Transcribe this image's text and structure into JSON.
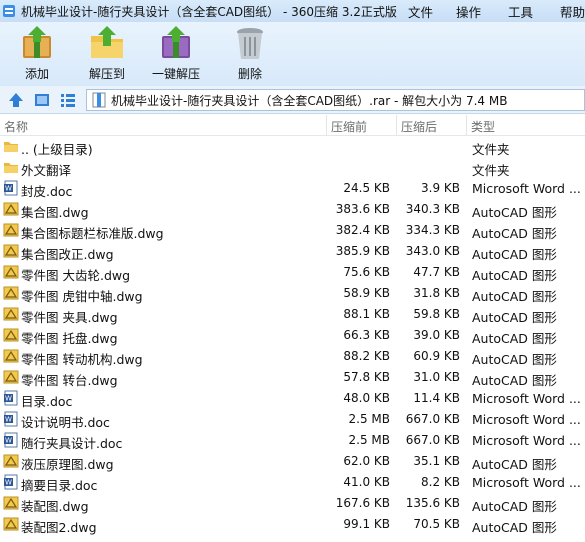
{
  "window": {
    "title": "机械毕业设计-随行夹具设计（含全套CAD图纸） - 360压缩 3.2正式版"
  },
  "menu": {
    "items": [
      "文件",
      "操作",
      "工具",
      "帮助"
    ]
  },
  "toolbar": {
    "buttons": [
      {
        "label": "添加",
        "icon": "add-archive-icon"
      },
      {
        "label": "解压到",
        "icon": "extract-folder-icon"
      },
      {
        "label": "一键解压",
        "icon": "one-click-extract-icon"
      },
      {
        "label": "删除",
        "icon": "trash-can-icon"
      }
    ]
  },
  "address": {
    "path": "机械毕业设计-随行夹具设计（含全套CAD图纸）.rar - 解包大小为 7.4 MB"
  },
  "columns": {
    "name": "名称",
    "original": "压缩前",
    "compressed": "压缩后",
    "type": "类型"
  },
  "files": [
    {
      "name": ".. (上级目录)",
      "original": "",
      "compressed": "",
      "type": "文件夹",
      "icon": "folder-icon"
    },
    {
      "name": "外文翻译",
      "original": "",
      "compressed": "",
      "type": "文件夹",
      "icon": "folder-icon"
    },
    {
      "name": "封皮.doc",
      "original": "24.5 KB",
      "compressed": "3.9 KB",
      "type": "Microsoft Word ...",
      "icon": "word-doc-icon"
    },
    {
      "name": "集合图.dwg",
      "original": "383.6 KB",
      "compressed": "340.3 KB",
      "type": "AutoCAD 图形",
      "icon": "autocad-dwg-icon"
    },
    {
      "name": "集合图标题栏标准版.dwg",
      "original": "382.4 KB",
      "compressed": "334.3 KB",
      "type": "AutoCAD 图形",
      "icon": "autocad-dwg-icon"
    },
    {
      "name": "集合图改正.dwg",
      "original": "385.9 KB",
      "compressed": "343.0 KB",
      "type": "AutoCAD 图形",
      "icon": "autocad-dwg-icon"
    },
    {
      "name": "零件图 大齿轮.dwg",
      "original": "75.6 KB",
      "compressed": "47.7 KB",
      "type": "AutoCAD 图形",
      "icon": "autocad-dwg-icon"
    },
    {
      "name": "零件图 虎钳中轴.dwg",
      "original": "58.9 KB",
      "compressed": "31.8 KB",
      "type": "AutoCAD 图形",
      "icon": "autocad-dwg-icon"
    },
    {
      "name": "零件图 夹具.dwg",
      "original": "88.1 KB",
      "compressed": "59.8 KB",
      "type": "AutoCAD 图形",
      "icon": "autocad-dwg-icon"
    },
    {
      "name": "零件图 托盘.dwg",
      "original": "66.3 KB",
      "compressed": "39.0 KB",
      "type": "AutoCAD 图形",
      "icon": "autocad-dwg-icon"
    },
    {
      "name": "零件图 转动机构.dwg",
      "original": "88.2 KB",
      "compressed": "60.9 KB",
      "type": "AutoCAD 图形",
      "icon": "autocad-dwg-icon"
    },
    {
      "name": "零件图 转台.dwg",
      "original": "57.8 KB",
      "compressed": "31.0 KB",
      "type": "AutoCAD 图形",
      "icon": "autocad-dwg-icon"
    },
    {
      "name": "目录.doc",
      "original": "48.0 KB",
      "compressed": "11.4 KB",
      "type": "Microsoft Word ...",
      "icon": "word-doc-icon"
    },
    {
      "name": "设计说明书.doc",
      "original": "2.5 MB",
      "compressed": "667.0 KB",
      "type": "Microsoft Word ...",
      "icon": "word-doc-icon"
    },
    {
      "name": "随行夹具设计.doc",
      "original": "2.5 MB",
      "compressed": "667.0 KB",
      "type": "Microsoft Word ...",
      "icon": "word-doc-icon"
    },
    {
      "name": "液压原理图.dwg",
      "original": "62.0 KB",
      "compressed": "35.1 KB",
      "type": "AutoCAD 图形",
      "icon": "autocad-dwg-icon"
    },
    {
      "name": "摘要目录.doc",
      "original": "41.0 KB",
      "compressed": "8.2 KB",
      "type": "Microsoft Word ...",
      "icon": "word-doc-icon"
    },
    {
      "name": "装配图.dwg",
      "original": "167.6 KB",
      "compressed": "135.6 KB",
      "type": "AutoCAD 图形",
      "icon": "autocad-dwg-icon"
    },
    {
      "name": "装配图2.dwg",
      "original": "99.1 KB",
      "compressed": "70.5 KB",
      "type": "AutoCAD 图形",
      "icon": "autocad-dwg-icon"
    }
  ]
}
